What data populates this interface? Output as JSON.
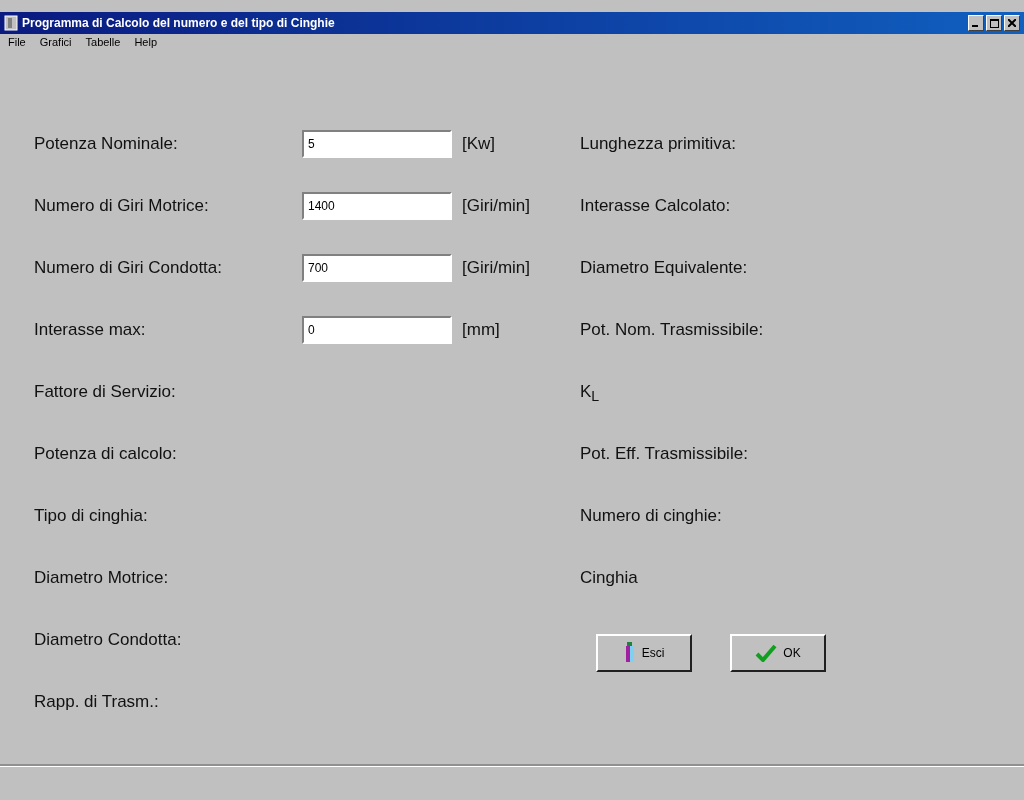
{
  "window": {
    "title": "Programma di Calcolo del numero e del tipo di Cinghie"
  },
  "menu": [
    {
      "label": "File"
    },
    {
      "label": "Grafici"
    },
    {
      "label": "Tabelle"
    },
    {
      "label": "Help"
    }
  ],
  "left_fields": [
    {
      "label": "Potenza Nominale:",
      "value": "5",
      "unit": "[Kw]"
    },
    {
      "label": "Numero di Giri Motrice:",
      "value": "1400",
      "unit": "[Giri/min]"
    },
    {
      "label": "Numero di Giri Condotta:",
      "value": "700",
      "unit": "[Giri/min]"
    },
    {
      "label": "Interasse max:",
      "value": "0",
      "unit": "[mm]"
    },
    {
      "label": "Fattore di Servizio:"
    },
    {
      "label": "Potenza di calcolo:"
    },
    {
      "label": "Tipo di cinghia:"
    },
    {
      "label": "Diametro Motrice:"
    },
    {
      "label": "Diametro Condotta:"
    },
    {
      "label": "Rapp. di Trasm.:"
    }
  ],
  "right_labels": [
    "Lunghezza primitiva:",
    "Interasse Calcolato:",
    "Diametro Equivalente:",
    "Pot. Nom. Trasmissibile:",
    "K$_{L}$",
    "Pot. Eff. Trasmissibile:",
    "Numero di cinghie:",
    "Cinghia"
  ],
  "buttons": [
    {
      "kind": "exit",
      "label": "Esci"
    },
    {
      "kind": "ok",
      "label": "OK"
    }
  ]
}
